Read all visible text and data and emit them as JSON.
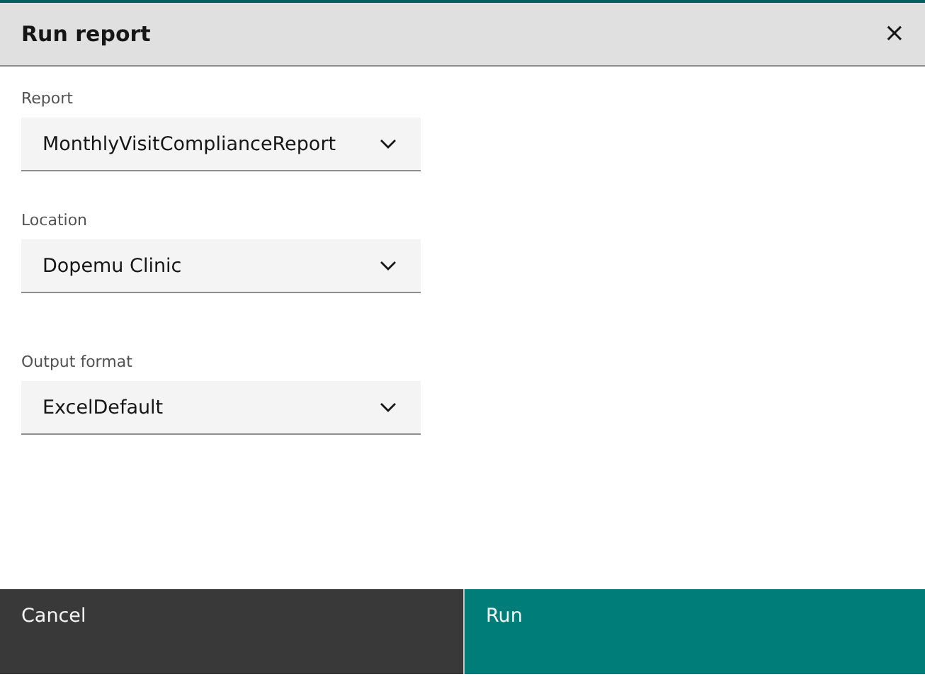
{
  "dialog": {
    "title": "Run report",
    "close": "×"
  },
  "fields": [
    {
      "label": "Report",
      "value": "MonthlyVisitComplianceReport"
    },
    {
      "label": "Location",
      "value": "Dopemu Clinic"
    },
    {
      "label": "Output format",
      "value": "ExcelDefault"
    }
  ],
  "buttons": [
    {
      "label": "Cancel",
      "kind": "secondary"
    },
    {
      "label": "Run",
      "kind": "primary"
    }
  ]
}
